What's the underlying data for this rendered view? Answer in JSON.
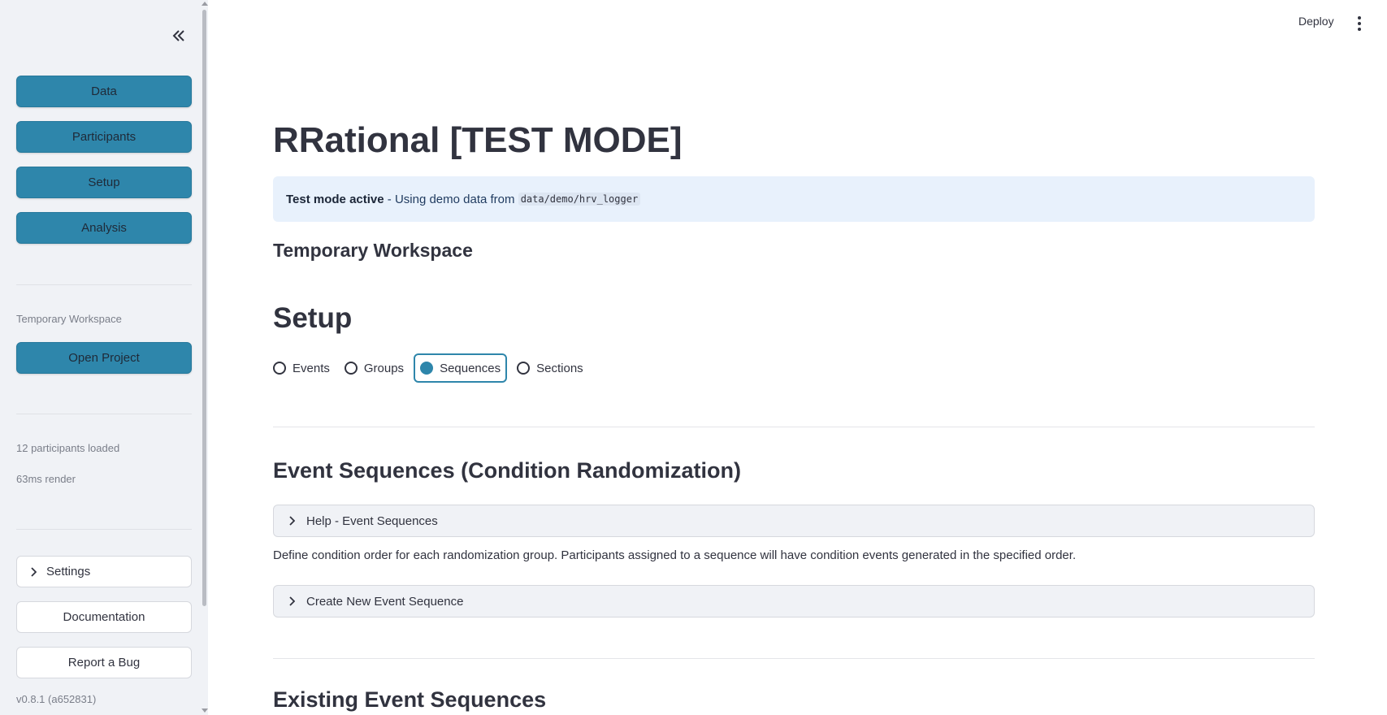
{
  "sidebar": {
    "nav": [
      "Data",
      "Participants",
      "Setup",
      "Analysis"
    ],
    "workspace_caption": "Temporary Workspace",
    "open_project_label": "Open Project",
    "participants_loaded": "12 participants loaded",
    "render_time": "63ms render",
    "settings_label": "Settings",
    "documentation_label": "Documentation",
    "report_bug_label": "Report a Bug",
    "version": "v0.8.1 (a652831)"
  },
  "header": {
    "deploy_label": "Deploy"
  },
  "main": {
    "title": "RRational [TEST MODE]",
    "info": {
      "bold": "Test mode active",
      "text": " - Using demo data from ",
      "code": "data/demo/hrv_logger"
    },
    "workspace_heading": "Temporary Workspace",
    "setup_heading": "Setup",
    "radio_options": [
      "Events",
      "Groups",
      "Sequences",
      "Sections"
    ],
    "radio_selected": "Sequences",
    "event_sequences_heading": "Event Sequences (Condition Randomization)",
    "help_expander": "Help - Event Sequences",
    "description": "Define condition order for each randomization group. Participants assigned to a sequence will have condition events generated in the specified order.",
    "create_expander": "Create New Event Sequence",
    "existing_heading": "Existing Event Sequences"
  },
  "colors": {
    "accent": "#2e86ab",
    "sidebar_bg": "#f0f2f6",
    "info_bg": "#e8f1fc"
  },
  "icons": {
    "collapse": "double-chevron-left-icon",
    "expander": "chevron-right-icon",
    "menu": "kebab-menu-icon"
  }
}
